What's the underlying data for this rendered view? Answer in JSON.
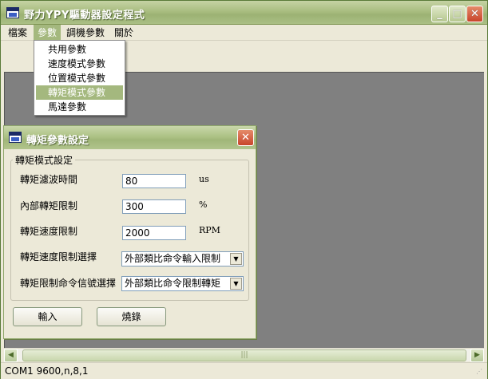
{
  "window": {
    "title": "野力YPY驅動器設定程式"
  },
  "menubar": {
    "items": [
      "檔案",
      "參數",
      "調機參數",
      "關於"
    ]
  },
  "dropdown": {
    "items": [
      "共用參數",
      "速度模式參數",
      "位置模式參數",
      "轉矩模式參數",
      "馬達參數"
    ],
    "highlighted": "轉矩模式參數"
  },
  "dialog": {
    "title": "轉矩參數設定",
    "group_label": "轉矩模式設定",
    "rows": [
      {
        "label": "轉矩濾波時間",
        "value": "80",
        "unit": "us"
      },
      {
        "label": "內部轉矩限制",
        "value": "300",
        "unit": "%"
      },
      {
        "label": "轉矩速度限制",
        "value": "2000",
        "unit": "RPM"
      }
    ],
    "selects": [
      {
        "label": "轉矩速度限制選擇",
        "value": "外部類比命令輸入限制"
      },
      {
        "label": "轉矩限制命令信號選擇",
        "value": "外部類比命令限制轉矩"
      }
    ],
    "buttons": {
      "input": "輸入",
      "burn": "燒錄"
    }
  },
  "status": {
    "text": "COM1 9600,n,8,1"
  },
  "accent_colors": {
    "titlebar": "#a9bd80",
    "highlight": "#a4b87e",
    "close": "#c8442a",
    "workspace": "#808080"
  }
}
